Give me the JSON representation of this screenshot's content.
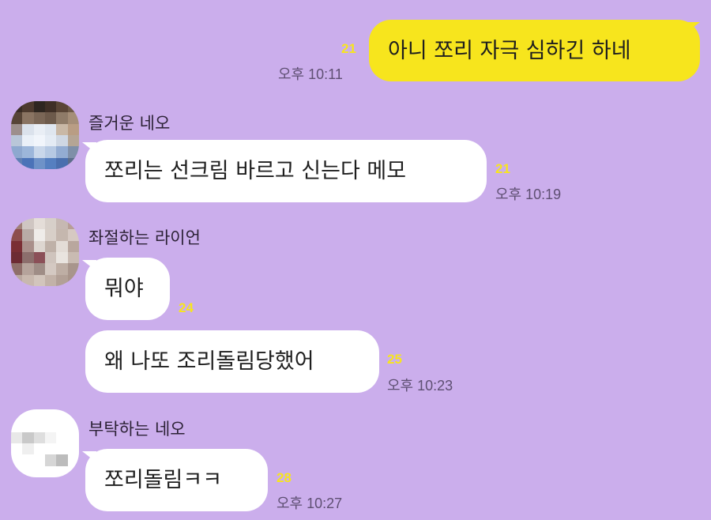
{
  "messages": [
    {
      "sender": "",
      "text": "아니 쪼리 자극 심하긴 하네",
      "unread": "21",
      "time": "오후 10:11"
    },
    {
      "sender": "즐거운 네오",
      "text": "쪼리는 선크림 바르고 신는다 메모",
      "unread": "21",
      "time": "오후 10:19"
    },
    {
      "sender": "좌절하는 라이언",
      "text": "뭐야",
      "unread": "24",
      "time": ""
    },
    {
      "sender": "",
      "text": "왜 나또 조리돌림당했어",
      "unread": "25",
      "time": "오후 10:23"
    },
    {
      "sender": "부탁하는 네오",
      "text": "쪼리돌림ㅋㅋ",
      "unread": "28",
      "time": "오후 10:27"
    }
  ],
  "colors": {
    "background": "#cbaeec",
    "my_bubble": "#f7e51d",
    "other_bubble": "#ffffff",
    "unread_count": "#f7e51d"
  },
  "icons": {
    "avatar_1": "pixelated-profile-photo",
    "avatar_2": "pixelated-profile-photo",
    "avatar_3": "pixelated-profile-photo"
  }
}
